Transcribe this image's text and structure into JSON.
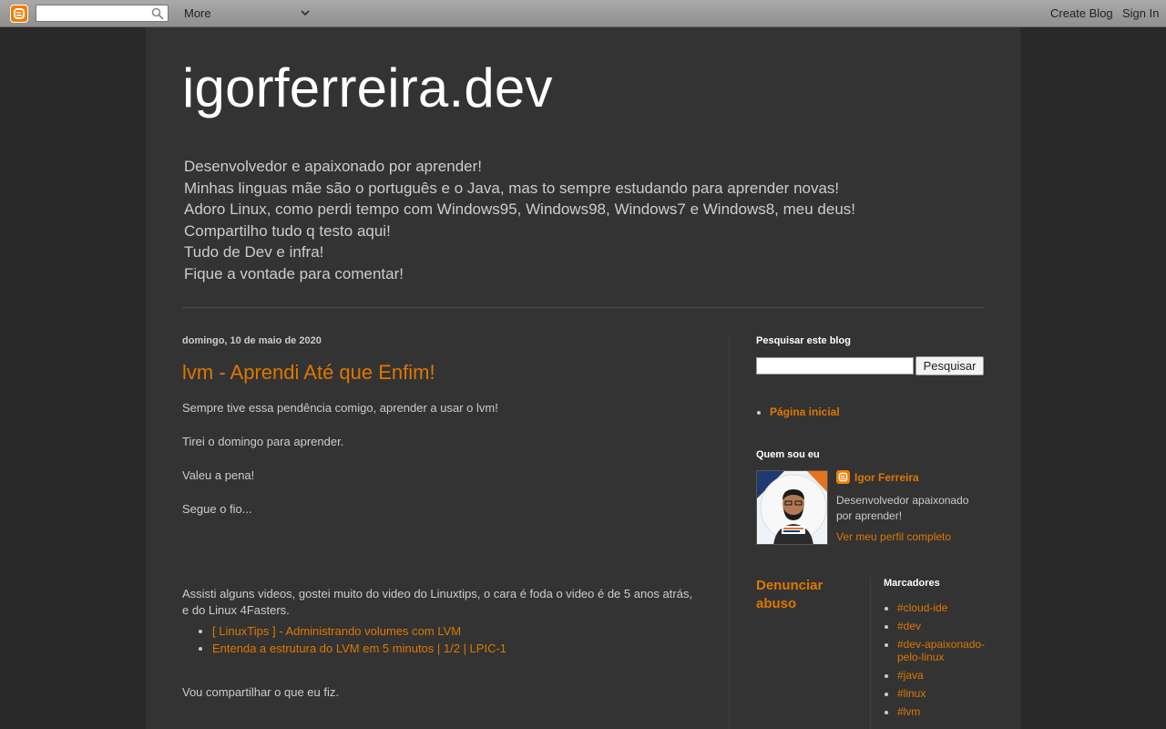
{
  "navbar": {
    "more_label": "More",
    "create_blog": "Create Blog",
    "sign_in": "Sign In"
  },
  "header": {
    "title": "igorferreira.dev",
    "description": [
      "Desenvolvedor e apaixonado por aprender!",
      "Minhas linguas mãe são o português e o Java, mas to sempre estudando para aprender novas!",
      "Adoro Linux, como perdi tempo com Windows95, Windows98, Windows7 e Windows8, meu deus!",
      "Compartilho tudo q testo aqui!",
      "Tudo de Dev e infra!",
      "Fique a vontade para comentar!"
    ]
  },
  "post": {
    "date": "domingo, 10 de maio de 2020",
    "title": "lvm - Aprendi Até que Enfim!",
    "paragraphs": [
      "Sempre tive essa pendência comigo, aprender a usar o lvm!",
      "Tirei o domingo para aprender.",
      "Valeu a pena!",
      "Segue o fio...",
      "Assisti alguns videos, gostei muito do video do Linuxtips, o cara é foda o video é de 5 anos atrás,",
      "e do Linux 4Fasters."
    ],
    "links": [
      "[ LinuxTips ] - Administrando volumes com LVM",
      "Entenda a estrutura do LVM em 5 minutos | 1/2 | LPIC-1"
    ],
    "closing": "Vou compartilhar o que eu fiz."
  },
  "sidebar": {
    "search_heading": "Pesquisar este blog",
    "search_value": "",
    "search_button": "Pesquisar",
    "pages": [
      "Página inicial"
    ],
    "about_heading": "Quem sou eu",
    "profile_name": "Igor Ferreira",
    "profile_desc": "Desenvolvedor apaixonado por aprender!",
    "profile_link": "Ver meu perfil completo",
    "report_abuse": "Denunciar abuso",
    "labels_heading": "Marcadores",
    "labels": [
      "#cloud-ide",
      "#dev",
      "#dev-apaixonado-pelo-linux",
      "#java",
      "#linux",
      "#lvm"
    ]
  },
  "colors": {
    "accent": "#dd7700",
    "background": "#292929",
    "container": "#333333",
    "text": "#cccccc",
    "blogger_brand": "#f57d00"
  }
}
